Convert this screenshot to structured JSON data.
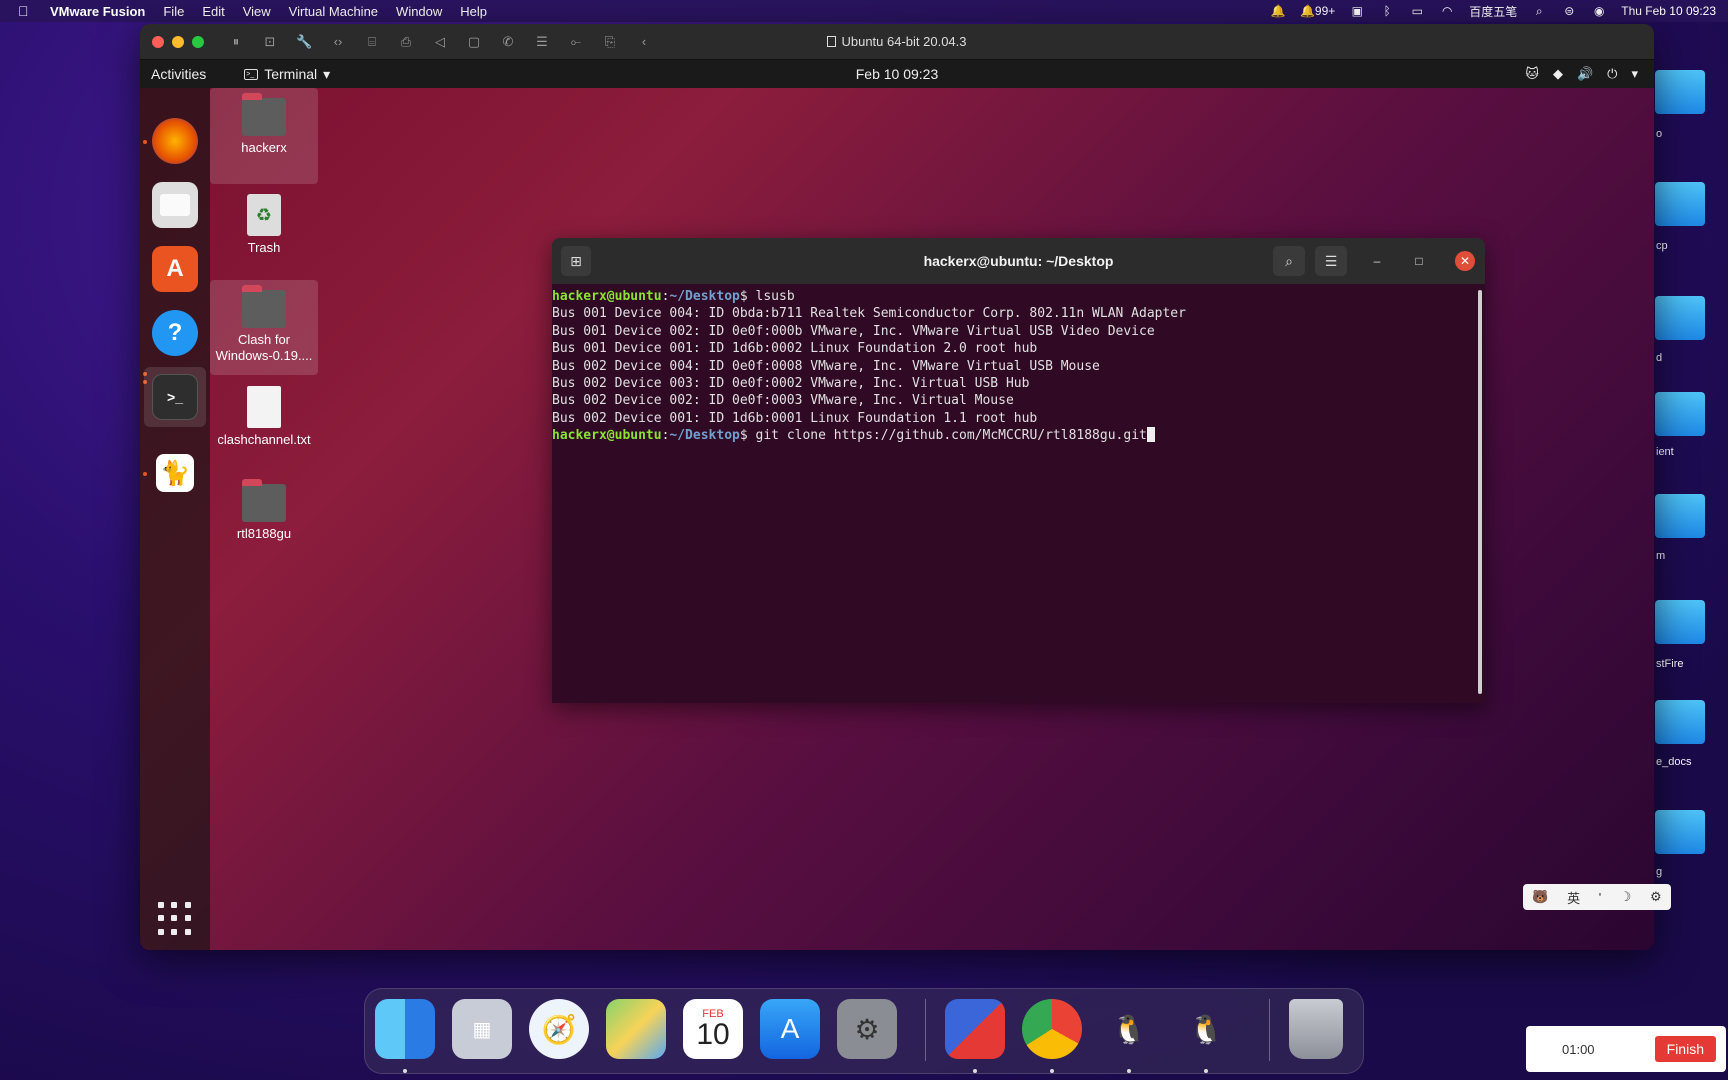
{
  "mac_menubar": {
    "apple": "",
    "app_name": "VMware Fusion",
    "menus": [
      "File",
      "Edit",
      "View",
      "Virtual Machine",
      "Window",
      "Help"
    ],
    "notifications": "99+",
    "ime": "百度五笔",
    "datetime": "Thu Feb 10  09:23"
  },
  "mac_desktop_labels": [
    "o",
    "cp",
    "d",
    "ient",
    "m",
    "stFire",
    "e_docs",
    "g"
  ],
  "vm": {
    "title": "Ubuntu 64-bit 20.04.3"
  },
  "ubuntu": {
    "activities": "Activities",
    "app_menu": "Terminal",
    "clock": "Feb 10  09:23",
    "desktop_icons": [
      {
        "label": "hackerx",
        "kind": "home-folder"
      },
      {
        "label": "Trash",
        "kind": "trash"
      },
      {
        "label": "Clash for Windows-0.19....",
        "kind": "folder"
      },
      {
        "label": "clashchannel.txt",
        "kind": "text-file"
      },
      {
        "label": "rtl8188gu",
        "kind": "folder"
      }
    ],
    "dock_apps": [
      "firefox",
      "files",
      "software",
      "help",
      "terminal",
      "clash"
    ]
  },
  "terminal": {
    "title": "hackerx@ubuntu: ~/Desktop",
    "prompt_user": "hackerx@ubuntu",
    "prompt_path": "~/Desktop",
    "command1": " lsusb",
    "output": [
      "Bus 001 Device 004: ID 0bda:b711 Realtek Semiconductor Corp. 802.11n WLAN Adapter",
      "Bus 001 Device 002: ID 0e0f:000b VMware, Inc. VMware Virtual USB Video Device",
      "Bus 001 Device 001: ID 1d6b:0002 Linux Foundation 2.0 root hub",
      "Bus 002 Device 004: ID 0e0f:0008 VMware, Inc. VMware Virtual USB Mouse",
      "Bus 002 Device 003: ID 0e0f:0002 VMware, Inc. Virtual USB Hub",
      "Bus 002 Device 002: ID 0e0f:0003 VMware, Inc. Virtual Mouse",
      "Bus 002 Device 001: ID 1d6b:0001 Linux Foundation 1.1 root hub"
    ],
    "command2": " git clone https://github.com/McMCCRU/rtl8188gu.git"
  },
  "ime_bar": {
    "lang": "英",
    "punct": "'",
    "moon": "☽"
  },
  "mac_dock": {
    "calendar_month": "FEB",
    "calendar_day": "10"
  },
  "recorder": {
    "time": "01:00",
    "finish": "Finish"
  }
}
